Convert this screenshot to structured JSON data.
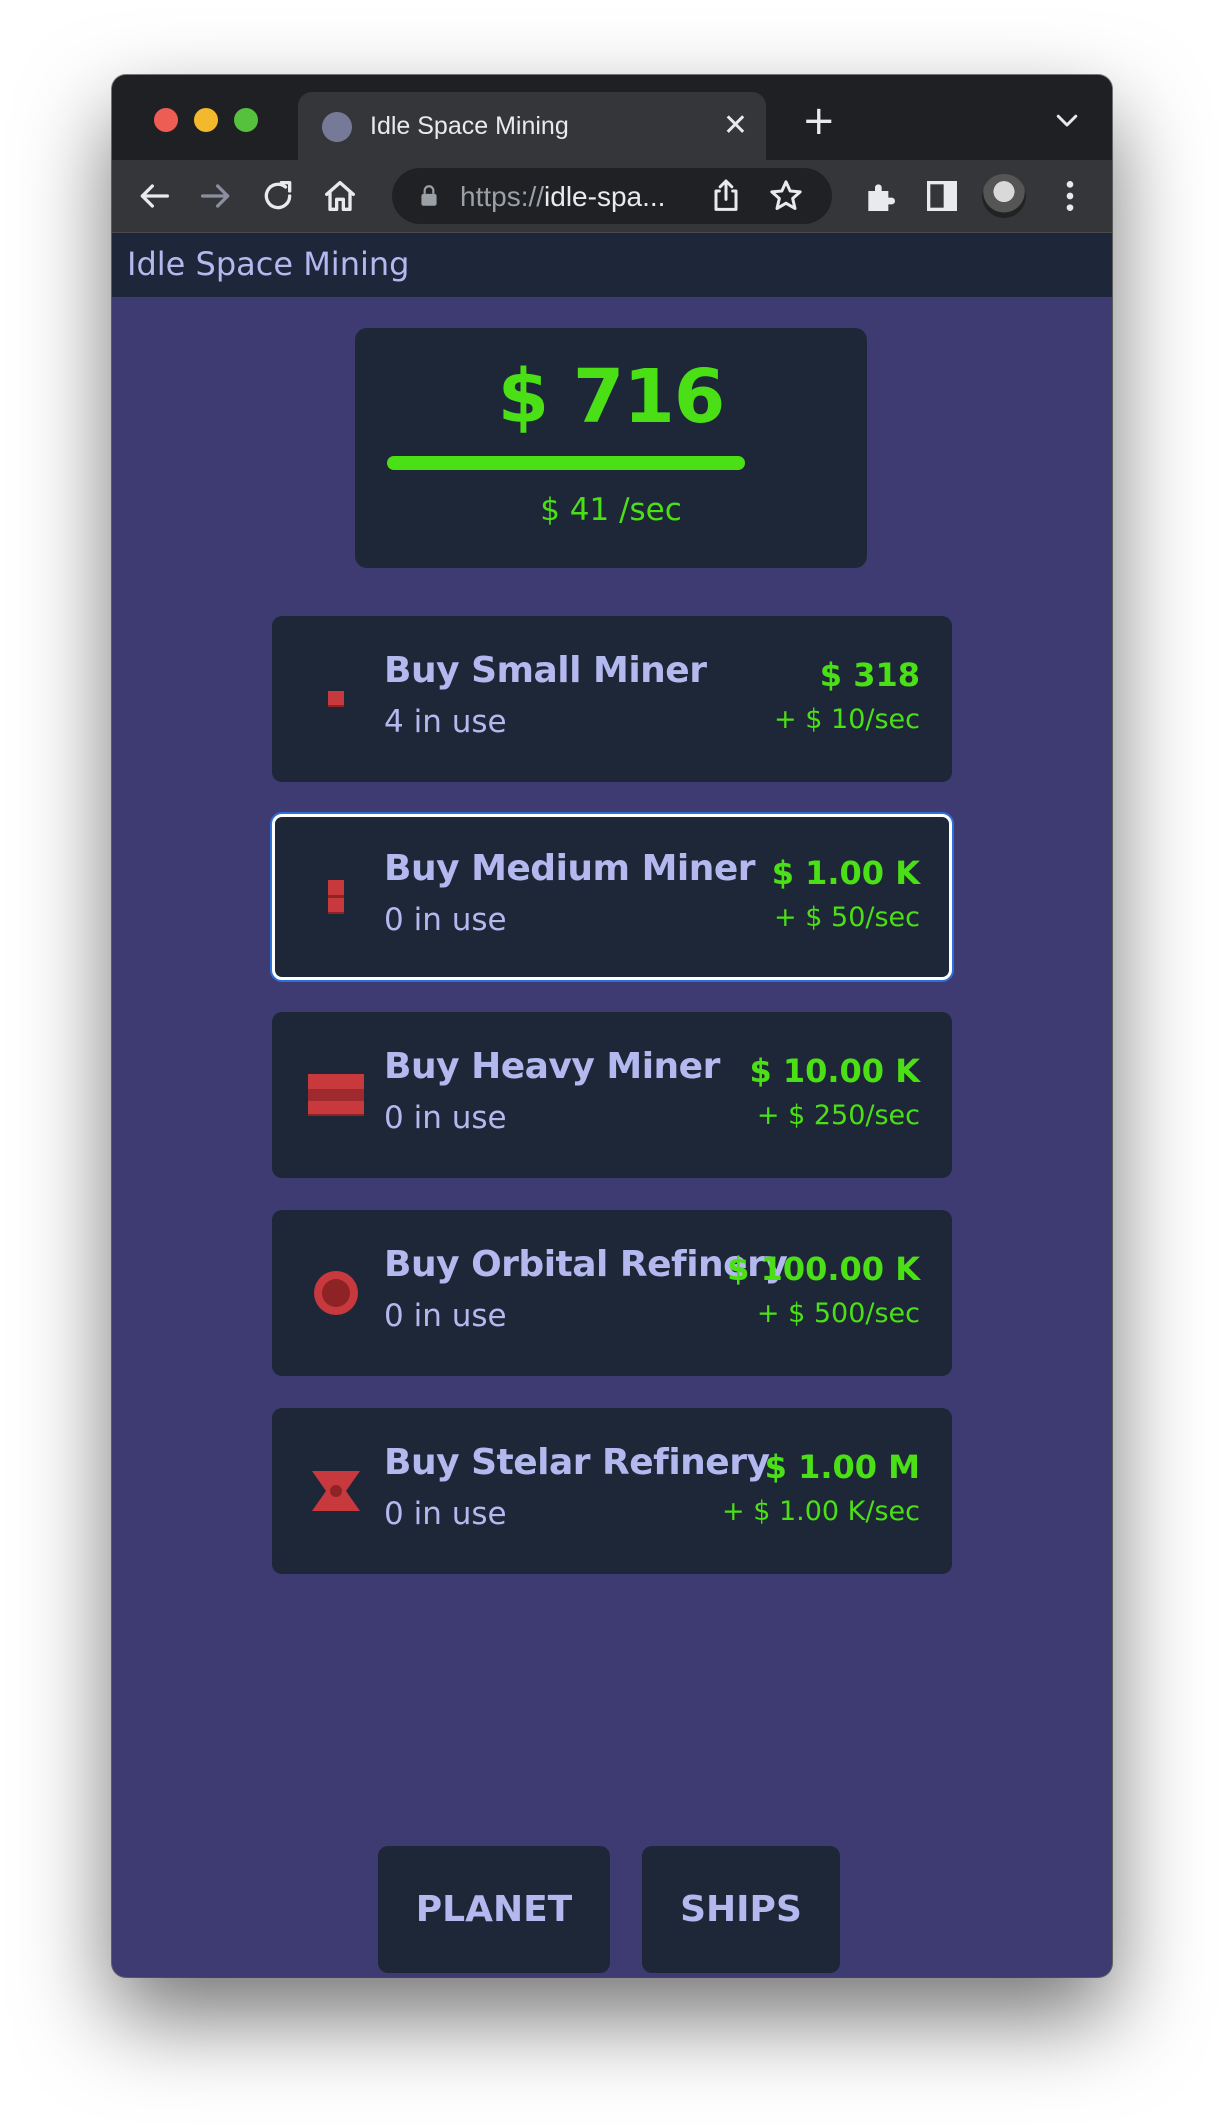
{
  "browser": {
    "tab_title": "Idle Space Mining",
    "tab_close_glyph": "✕",
    "new_tab_glyph": "+",
    "url_scheme": "https://",
    "url_host": "idle-spa...",
    "icons": [
      "back-icon",
      "forward-icon",
      "reload-icon",
      "home-icon",
      "lock-icon",
      "share-icon",
      "star-icon",
      "extensions-icon",
      "sidepanel-icon",
      "avatar",
      "menu-icon",
      "chevron-down-icon"
    ]
  },
  "app": {
    "title": "Idle Space Mining"
  },
  "money": {
    "amount": "$ 716",
    "rate": "$ 41 /sec",
    "progress_fraction": 1.0,
    "color": "#4be016"
  },
  "shop": {
    "items": [
      {
        "name": "Buy Small Miner",
        "count": "4 in use",
        "price": "$ 318",
        "rate": "+ $ 10/sec",
        "icon": "small-miner-icon"
      },
      {
        "name": "Buy Medium Miner",
        "count": "0 in use",
        "price": "$ 1.00 K",
        "rate": "+ $ 50/sec",
        "icon": "medium-miner-icon",
        "focused": true
      },
      {
        "name": "Buy Heavy Miner",
        "count": "0 in use",
        "price": "$ 10.00 K",
        "rate": "+ $ 250/sec",
        "icon": "heavy-miner-icon"
      },
      {
        "name": "Buy Orbital Refinery",
        "count": "0 in use",
        "price": "$ 100.00 K",
        "rate": "+ $ 500/sec",
        "icon": "orbital-refinery-icon"
      },
      {
        "name": "Buy Stelar Refinery",
        "count": "0 in use",
        "price": "$ 1.00 M",
        "rate": "+ $ 1.00 K/sec",
        "icon": "stelar-refinery-icon"
      }
    ]
  },
  "nav": {
    "planet": "PLANET",
    "ships": "SHIPS"
  },
  "colors": {
    "background": "#3d3b72",
    "card": "#1e2738",
    "text": "#b3b8ee",
    "accent_green": "#4be016",
    "icon_red": "#c8393d"
  }
}
